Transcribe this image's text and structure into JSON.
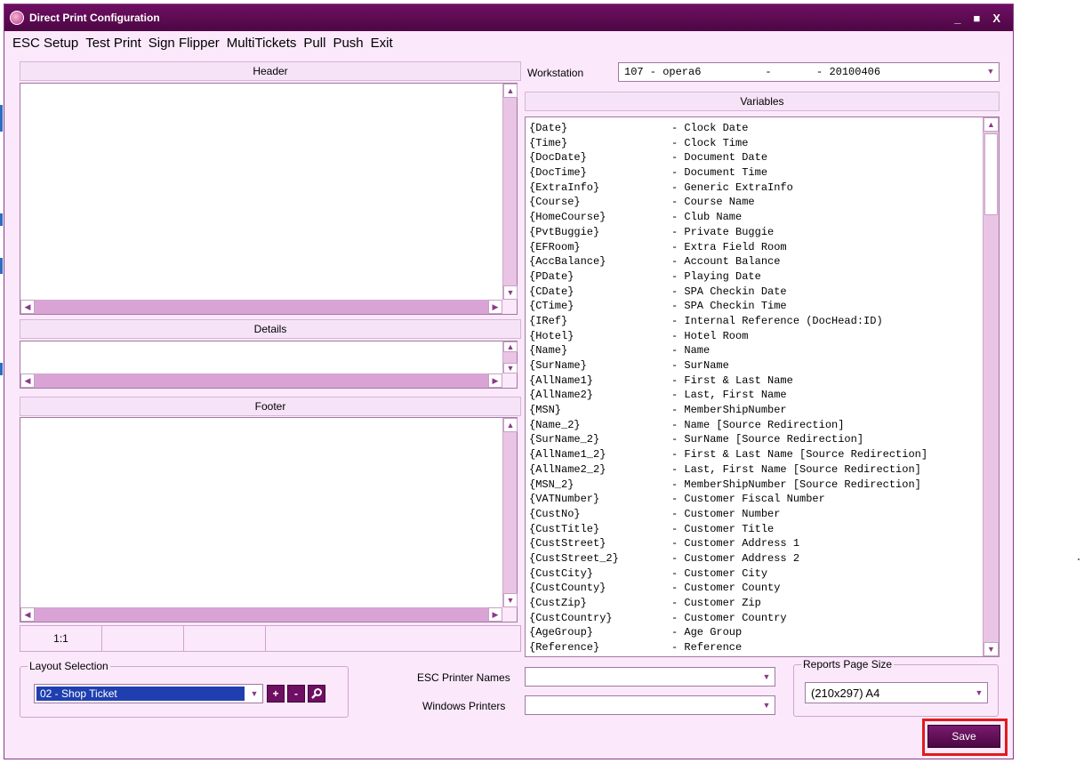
{
  "window": {
    "title": "Direct Print Configuration",
    "controls": {
      "minimize": "_",
      "maximize": "■",
      "close": "X"
    }
  },
  "menu": [
    "ESC Setup",
    "Test Print",
    "Sign Flipper",
    "MultiTickets",
    "Pull",
    "Push",
    "Exit"
  ],
  "sections": {
    "header": "Header",
    "details": "Details",
    "footer": "Footer"
  },
  "status": {
    "position": "1:1"
  },
  "workstation": {
    "label": "Workstation",
    "value": "107 - opera6          -       - 20100406"
  },
  "variables": {
    "title": "Variables",
    "items": [
      {
        "name": "{Date}",
        "desc": "- Clock Date"
      },
      {
        "name": "{Time}",
        "desc": "- Clock Time"
      },
      {
        "name": "{DocDate}",
        "desc": "- Document Date"
      },
      {
        "name": "{DocTime}",
        "desc": "- Document Time"
      },
      {
        "name": "{ExtraInfo}",
        "desc": "- Generic ExtraInfo"
      },
      {
        "name": "{Course}",
        "desc": "- Course Name"
      },
      {
        "name": "{HomeCourse}",
        "desc": "- Club Name"
      },
      {
        "name": "{PvtBuggie}",
        "desc": "- Private Buggie"
      },
      {
        "name": "{EFRoom}",
        "desc": "- Extra Field Room"
      },
      {
        "name": "{AccBalance}",
        "desc": "- Account Balance"
      },
      {
        "name": "{PDate}",
        "desc": "- Playing Date"
      },
      {
        "name": "{CDate}",
        "desc": "- SPA Checkin Date"
      },
      {
        "name": "{CTime}",
        "desc": "- SPA Checkin Time"
      },
      {
        "name": "{IRef}",
        "desc": "- Internal Reference (DocHead:ID)"
      },
      {
        "name": "{Hotel}",
        "desc": "- Hotel Room"
      },
      {
        "name": "{Name}",
        "desc": "- Name"
      },
      {
        "name": "{SurName}",
        "desc": "- SurName"
      },
      {
        "name": "{AllName1}",
        "desc": "- First & Last Name"
      },
      {
        "name": "{AllName2}",
        "desc": "- Last, First Name"
      },
      {
        "name": "{MSN}",
        "desc": "- MemberShipNumber"
      },
      {
        "name": "{Name_2}",
        "desc": "- Name [Source Redirection]"
      },
      {
        "name": "{SurName_2}",
        "desc": "- SurName [Source Redirection]"
      },
      {
        "name": "{AllName1_2}",
        "desc": "- First & Last Name [Source Redirection]"
      },
      {
        "name": "{AllName2_2}",
        "desc": "- Last, First Name [Source Redirection]"
      },
      {
        "name": "{MSN_2}",
        "desc": "- MemberShipNumber [Source Redirection]"
      },
      {
        "name": "{VATNumber}",
        "desc": "- Customer Fiscal Number"
      },
      {
        "name": "{CustNo}",
        "desc": "- Customer Number"
      },
      {
        "name": "{CustTitle}",
        "desc": "- Customer Title"
      },
      {
        "name": "{CustStreet}",
        "desc": "- Customer Address 1"
      },
      {
        "name": "{CustStreet_2}",
        "desc": "- Customer Address 2"
      },
      {
        "name": "{CustCity}",
        "desc": "- Customer City"
      },
      {
        "name": "{CustCounty}",
        "desc": "- Customer County"
      },
      {
        "name": "{CustZip}",
        "desc": "- Customer Zip"
      },
      {
        "name": "{CustCountry}",
        "desc": "- Customer Country"
      },
      {
        "name": "{AgeGroup}",
        "desc": "- Age Group"
      },
      {
        "name": "{Reference}",
        "desc": "- Reference"
      }
    ]
  },
  "layout": {
    "legend": "Layout Selection",
    "selected": "02 - Shop Ticket",
    "add_label": "+",
    "remove_label": "-"
  },
  "printers": {
    "esc_label": "ESC Printer Names",
    "esc_value": "",
    "windows_label": "Windows Printers",
    "windows_value": ""
  },
  "page_size": {
    "legend": "Reports Page Size",
    "value": "(210x297) A4"
  },
  "save_label": "Save",
  "icons": {
    "app": "app-logo-icon",
    "search": "magnifier-icon",
    "dropdown": "chevron-down-icon"
  }
}
